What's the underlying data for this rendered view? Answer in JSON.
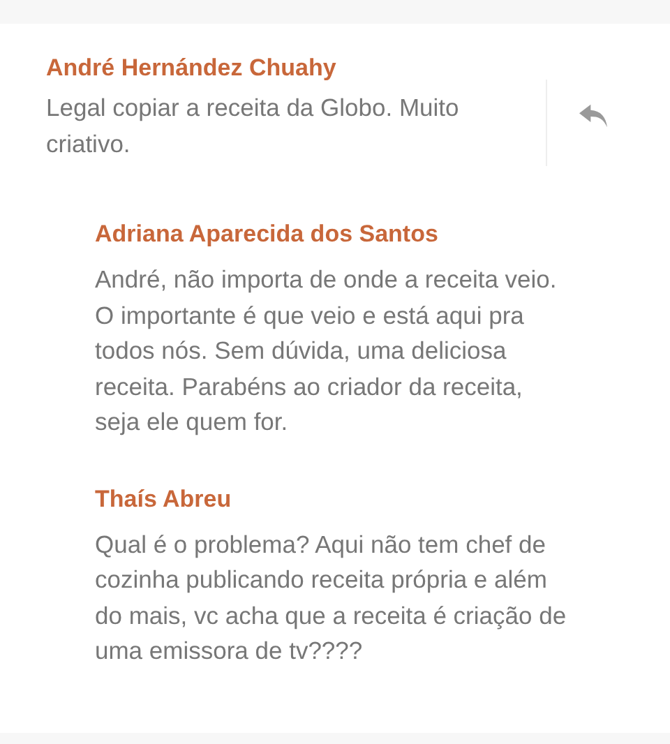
{
  "comments": [
    {
      "author": "André Hernández Chuahy",
      "text": "Legal copiar a receita da Globo. Muito criativo.",
      "children": [
        {
          "author": "Adriana Aparecida dos Santos",
          "text": "André, não importa de onde a receita veio. O importante é que veio e está aqui pra todos nós. Sem dúvida, uma deliciosa receita. Parabéns ao criador da receita, seja ele quem for."
        },
        {
          "author": "Thaís Abreu",
          "text": "Qual é o problema? Aqui não tem chef de cozinha publicando receita própria e além do mais, vc acha que a receita é criação de uma emissora de tv????"
        }
      ]
    }
  ]
}
